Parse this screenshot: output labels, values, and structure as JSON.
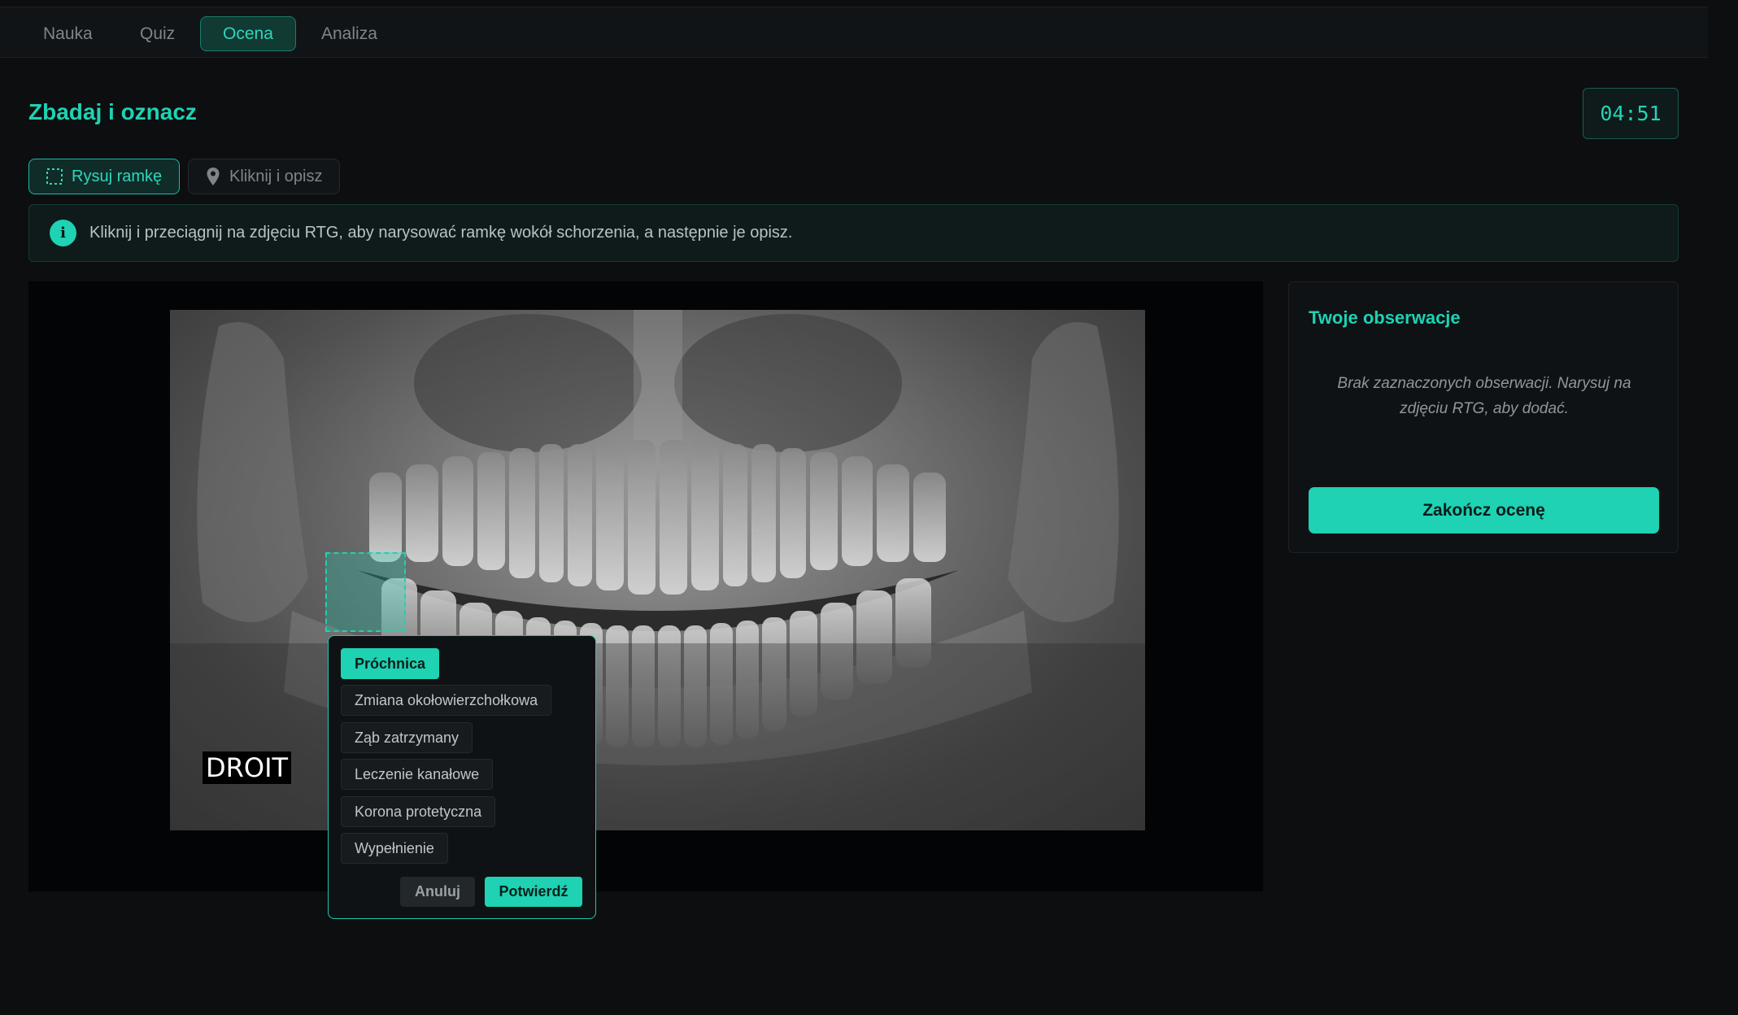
{
  "tabs": [
    {
      "label": "Nauka",
      "active": false
    },
    {
      "label": "Quiz",
      "active": false
    },
    {
      "label": "Ocena",
      "active": true
    },
    {
      "label": "Analiza",
      "active": false
    }
  ],
  "page_title": "Zbadaj i oznacz",
  "timer": "04:51",
  "modes": {
    "draw_box": {
      "label": "Rysuj ramkę",
      "icon": "dashed-square-icon",
      "active": true
    },
    "click_describe": {
      "label": "Kliknij i opisz",
      "icon": "map-pin-icon",
      "active": false
    }
  },
  "info": {
    "icon": "info-icon",
    "text": "Kliknij i przeciągnij na zdjęciu RTG, aby narysować ramkę wokół schorzenia, a następnie je opisz."
  },
  "xray": {
    "overlay_label": "DROIT"
  },
  "popup": {
    "options": [
      "Próchnica",
      "Zmiana okołowierzchołkowa",
      "Ząb zatrzymany",
      "Leczenie kanałowe",
      "Korona protetyczna",
      "Wypełnienie"
    ],
    "selected": "Próchnica",
    "cancel_label": "Anuluj",
    "confirm_label": "Potwierdź"
  },
  "observations": {
    "title": "Twoje obserwacje",
    "empty_text": "Brak zaznaczonych obserwacji. Narysuj na zdjęciu RTG, aby dodać.",
    "finish_label": "Zakończ ocenę"
  },
  "colors": {
    "accent": "#1ed2b3",
    "background": "#0c0e10",
    "panel": "#0f1214"
  }
}
